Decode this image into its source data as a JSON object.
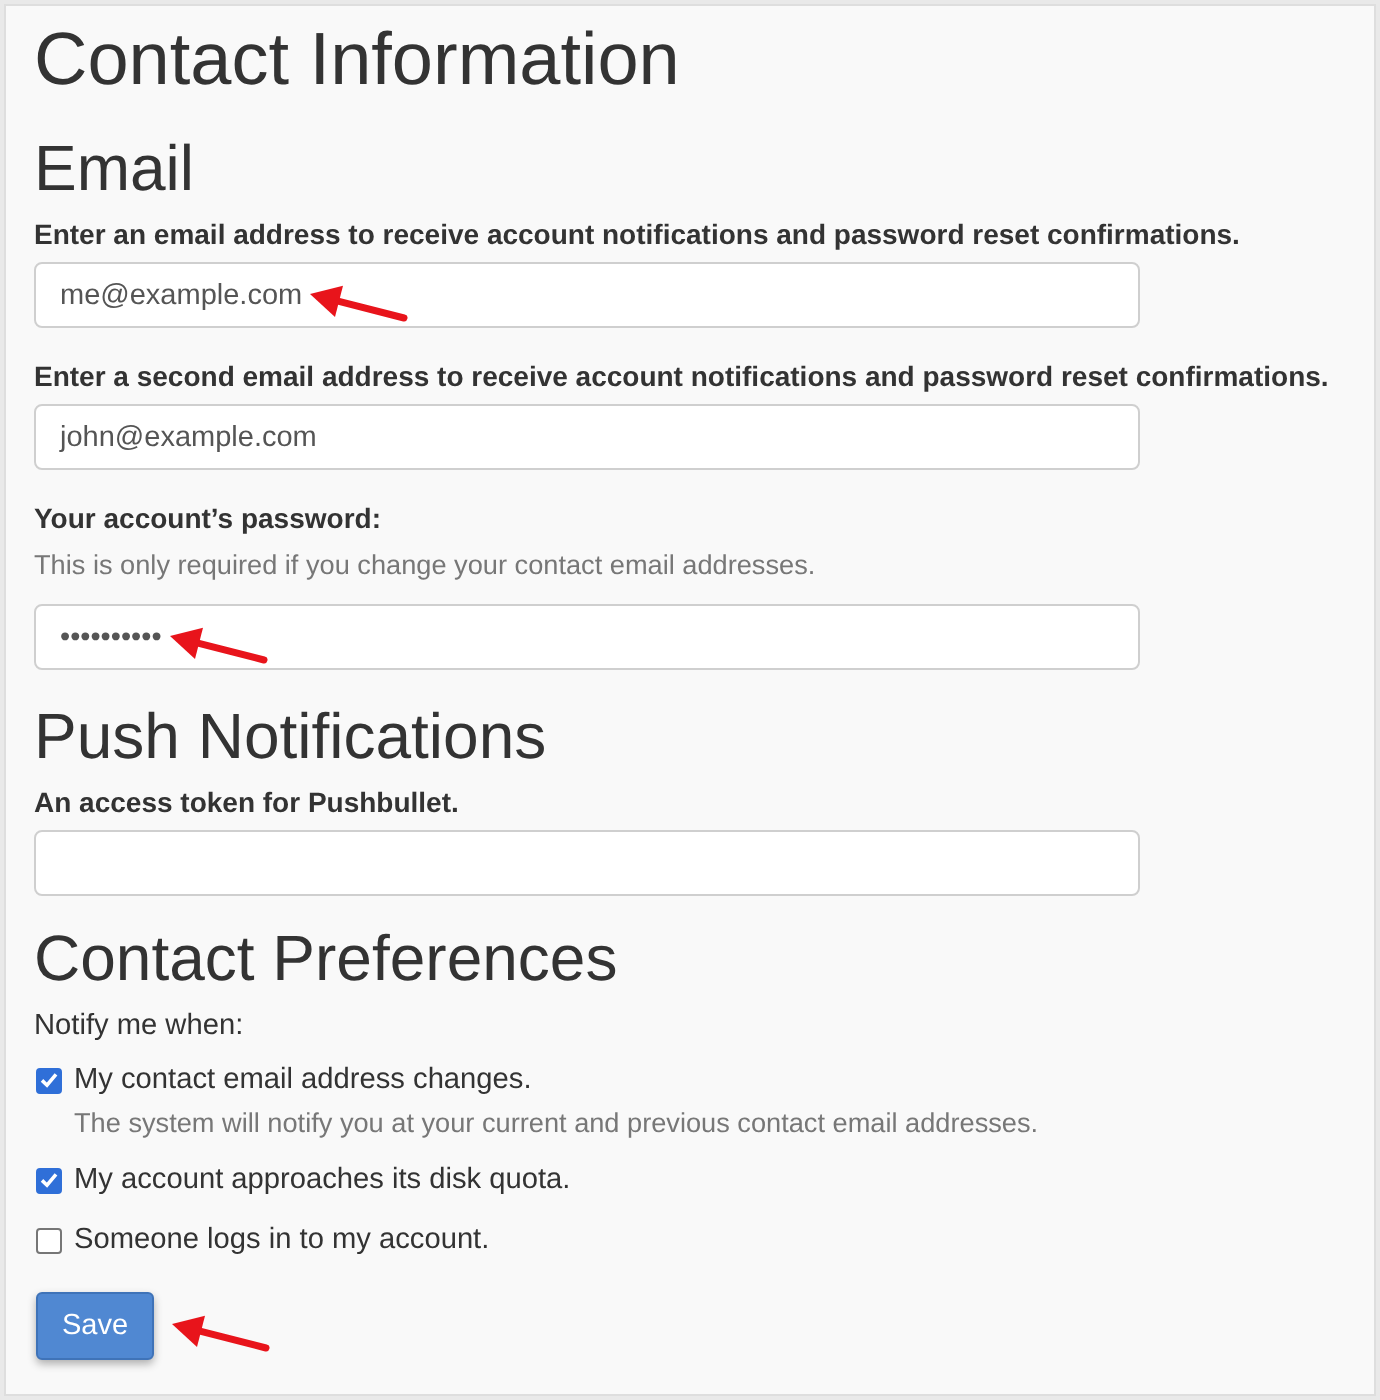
{
  "title": "Contact Information",
  "email": {
    "heading": "Email",
    "fields": [
      {
        "label": "Enter an email address to receive account notifications and password reset confirmations.",
        "value": "me@example.com",
        "annotated": true
      },
      {
        "label": "Enter a second email address to receive account notifications and password reset confirmations.",
        "value": "john@example.com",
        "annotated": false
      },
      {
        "label": "Your account’s password:",
        "help": "This is only required if you change your contact email addresses.",
        "value": "••••••••••",
        "annotated": true
      }
    ]
  },
  "push_notifications": {
    "heading": "Push Notifications",
    "fields": [
      {
        "label": "An access token for Pushbullet.",
        "annotated": false
      }
    ]
  },
  "contact_preferences": {
    "heading": "Contact Preferences",
    "intro": "Notify me when:",
    "options": [
      {
        "label": "My contact email address changes.",
        "help": "The system will notify you at your current and previous contact email addresses.",
        "checked": true
      },
      {
        "label": "My account approaches its disk quota.",
        "checked": true
      },
      {
        "label": "Someone logs in to my account.",
        "checked": false
      }
    ],
    "save_button": {
      "label": "Save",
      "annotated": true
    }
  }
}
